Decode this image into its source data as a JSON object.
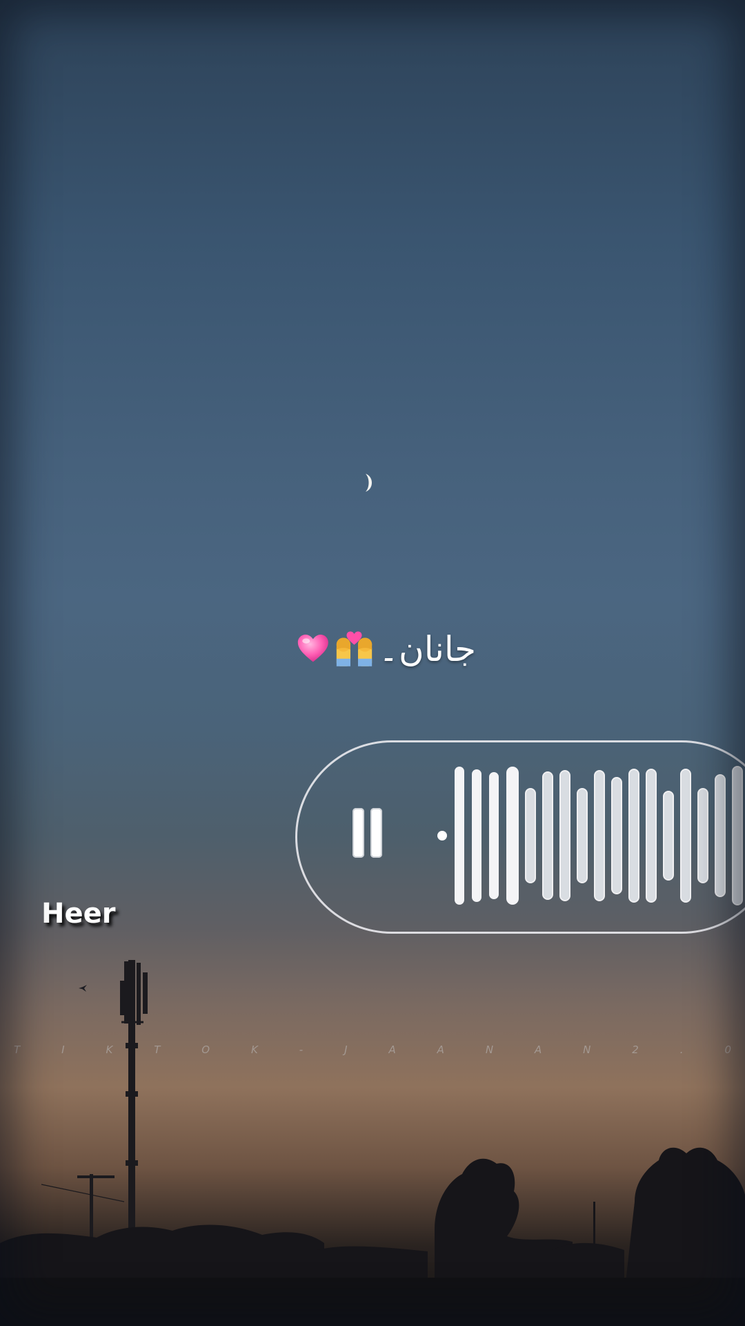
{
  "caption": {
    "urdu_text": "جانان۔",
    "emoji": [
      "couple-with-heart-icon",
      "pink-heart-icon"
    ]
  },
  "voice_note": {
    "state": "playing",
    "control_icon": "pause-icon",
    "bar_count": 17
  },
  "overlay_label": "Heer",
  "watermark_text": "T I K T O K  -  J A A N A N 2 . 0",
  "colors": {
    "sky_top": "#2d4258",
    "sky_mid": "#4b6681",
    "horizon_glow": "#8f725c",
    "silhouette": "#121214",
    "bubble_border": "#ebebf0",
    "caption_text": "#ffffff",
    "heart_pink": "#ff5fb4"
  }
}
